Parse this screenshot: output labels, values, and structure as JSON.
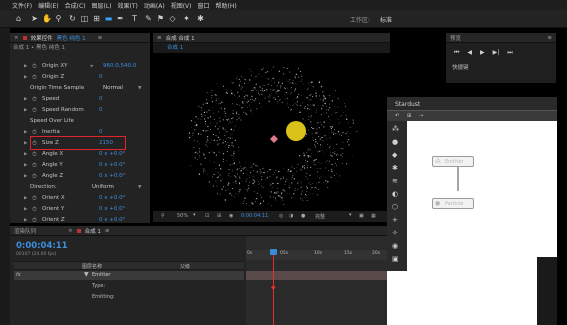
{
  "menu": [
    "文件(F)",
    "编辑(E)",
    "合成(C)",
    "图层(L)",
    "效果(T)",
    "动画(A)",
    "视图(V)",
    "窗口",
    "帮助(H)"
  ],
  "toolbar": {
    "workspace_label": "工作区:",
    "workspace_value": "标准"
  },
  "effect_panel": {
    "tab": "效果控件",
    "tab_target": "黑色 纯色 1",
    "layer_path": "合成 1 • 黑色 纯色 1",
    "rows": [
      {
        "label": "Origin XY",
        "value": "960.0,540.0"
      },
      {
        "label": "Origin Z",
        "value": "0"
      },
      {
        "label": "Origin Time Sample",
        "value": "Normal"
      },
      {
        "label": "Speed",
        "value": "0"
      },
      {
        "label": "Speed Random",
        "value": "0"
      },
      {
        "label": "Speed Over Life",
        "value": ""
      },
      {
        "label": "Inertia",
        "value": "0"
      },
      {
        "label": "Size Z",
        "value": "2150"
      },
      {
        "label": "Angle X",
        "value": "0 x +0.0°"
      },
      {
        "label": "Angle Y",
        "value": "0 x +0.0°"
      },
      {
        "label": "Angle Z",
        "value": "0 x +0.0°"
      },
      {
        "label": "Direction:",
        "value": "Uniform"
      },
      {
        "label": "Orient X",
        "value": "0 x +0.0°"
      },
      {
        "label": "Orient Y",
        "value": "0 x +0.0°"
      },
      {
        "label": "Orient Z",
        "value": "0 x +0.0°"
      }
    ]
  },
  "comp": {
    "tab": "合成 合成 1",
    "subtab": "合成 1",
    "zoom": "50%",
    "timecode": "0:00:04:11",
    "quality": "完整"
  },
  "timeline": {
    "tab_render": "渲染队列",
    "tab_comp": "合成 1",
    "timecode": "0:00:04:11",
    "frame_info": "00107 (24.00 fps)",
    "col_name": "图层名称",
    "col_parent": "父级",
    "layer_name": "Emitter",
    "props": [
      "Type:",
      "Emitting:"
    ],
    "ruler": [
      "0s",
      "05s",
      "10s",
      "15s",
      "20s"
    ]
  },
  "right_panel": {
    "title": "预览",
    "section": "快捷键"
  },
  "stardust": {
    "title": "Stardust",
    "node_emitter": "Emitter",
    "node_particle": "Particle"
  },
  "colors": {
    "accent": "#3aa3ff",
    "value_blue": "#3d8fe0",
    "highlight": "#e0242a",
    "playhead": "#e03030",
    "sun": "#d8c21a"
  }
}
